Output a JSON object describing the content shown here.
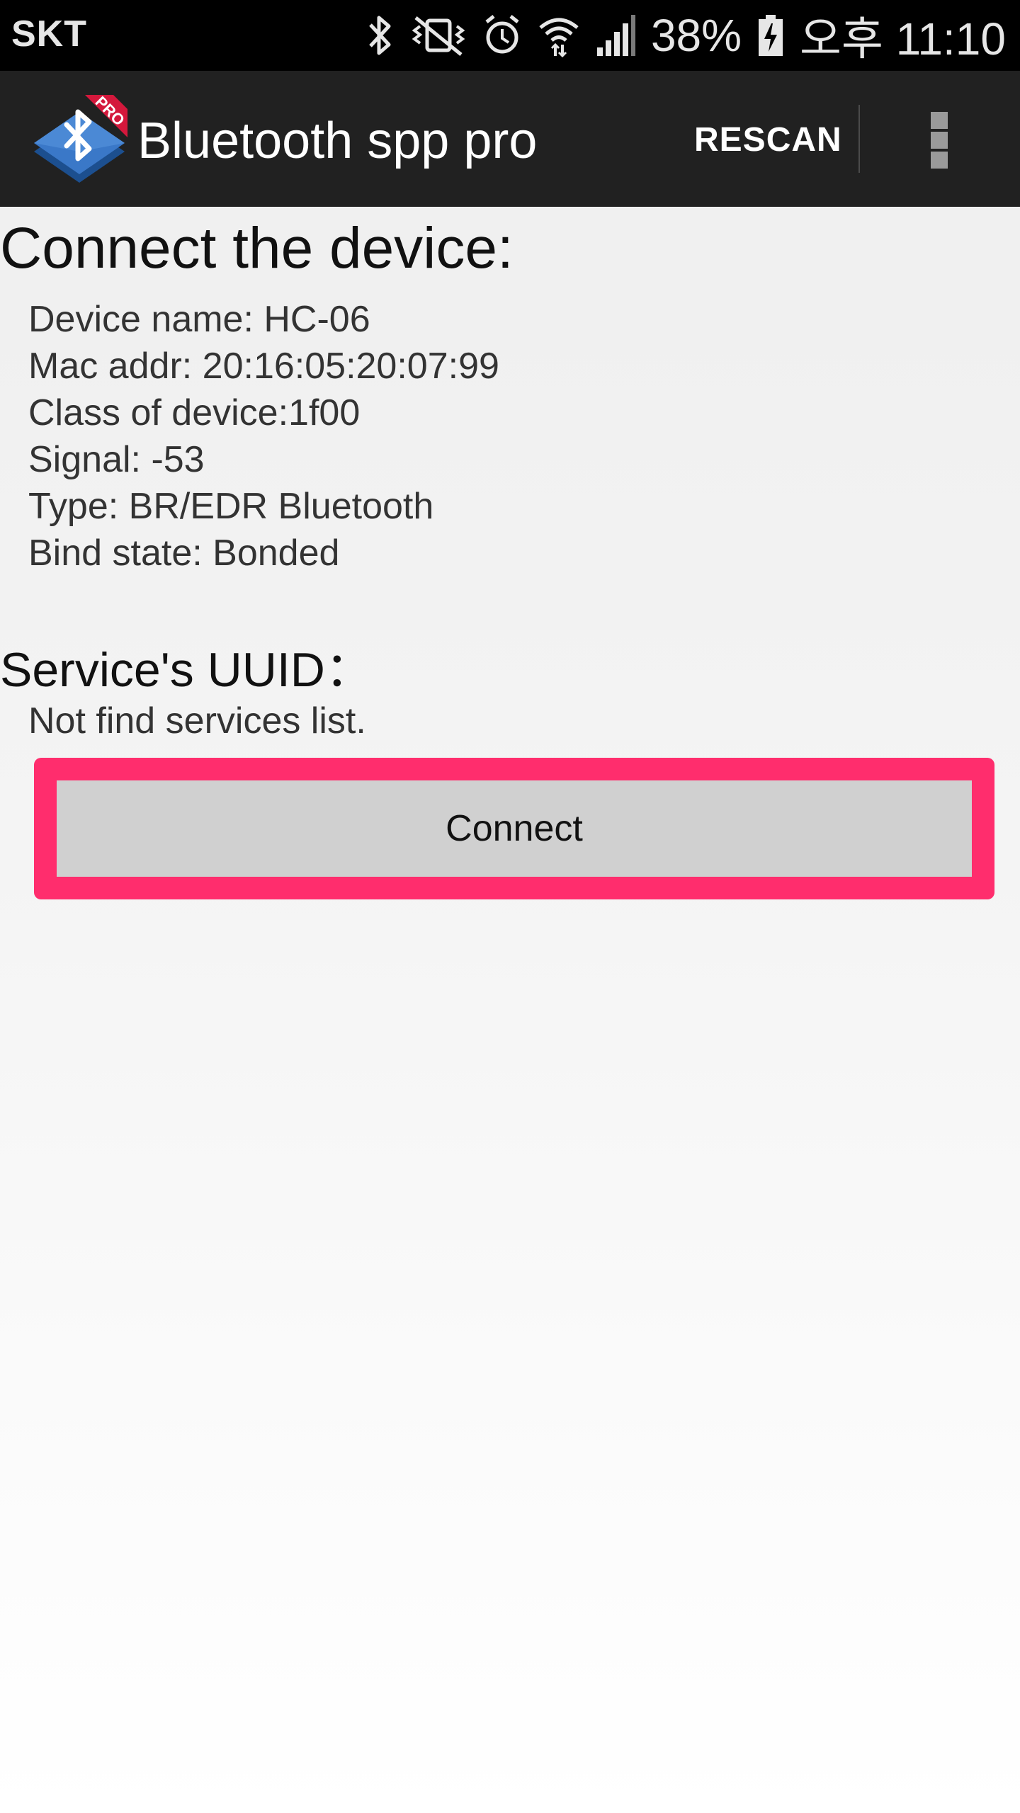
{
  "status_bar": {
    "carrier": "SKT",
    "battery_percent": "38%",
    "time": "오후 11:10",
    "icons": [
      "bluetooth-icon",
      "vibrate-mute-icon",
      "alarm-icon",
      "wifi-icon",
      "signal-icon",
      "battery-charging-icon"
    ]
  },
  "action_bar": {
    "title": "Bluetooth spp pro",
    "rescan_label": "RESCAN",
    "app_icon": "bluetooth-spp-pro-logo",
    "icon_badge": "PRO",
    "overflow_icon": "more-vert-icon"
  },
  "device": {
    "heading": "Connect the device:",
    "name_line": "Device name: HC-06",
    "mac_line": "Mac addr: 20:16:05:20:07:99",
    "class_line": "Class of device:1f00",
    "signal_line": "Signal: -53",
    "type_line": "Type: BR/EDR Bluetooth",
    "bind_line": "Bind state: Bonded"
  },
  "services": {
    "heading": "Service's UUID：",
    "empty_message": "Not find services list."
  },
  "connect_button": {
    "label": "Connect"
  },
  "colors": {
    "status_bar": "#000000",
    "action_bar": "#212121",
    "highlight": "#ff2d6d",
    "button": "#d0d0d0"
  }
}
